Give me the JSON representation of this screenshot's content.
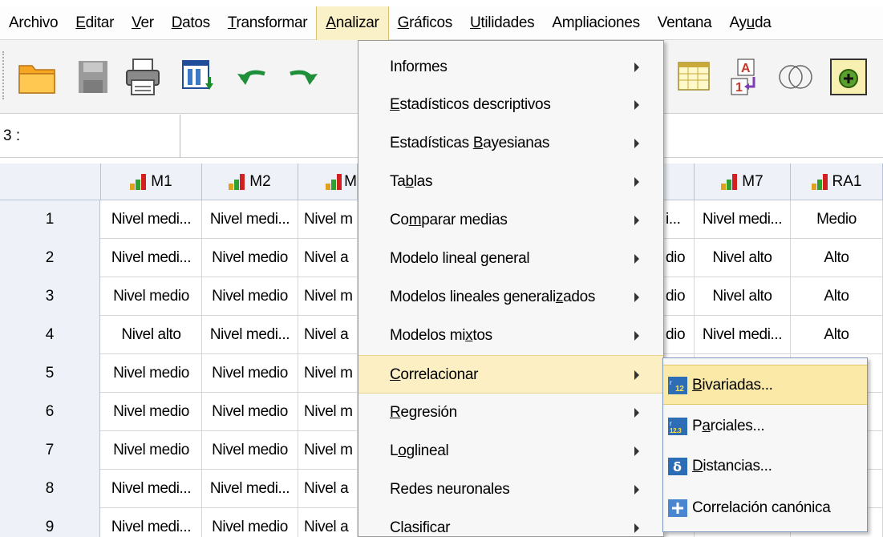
{
  "menubar": [
    {
      "pre": "Archivo",
      "u": "",
      "post": ""
    },
    {
      "pre": "",
      "u": "E",
      "post": "ditar"
    },
    {
      "pre": "",
      "u": "V",
      "post": "er"
    },
    {
      "pre": "",
      "u": "D",
      "post": "atos"
    },
    {
      "pre": "",
      "u": "T",
      "post": "ransformar"
    },
    {
      "pre": "",
      "u": "A",
      "post": "nalizar"
    },
    {
      "pre": "",
      "u": "G",
      "post": "ráficos"
    },
    {
      "pre": "",
      "u": "U",
      "post": "tilidades"
    },
    {
      "pre": "Ampliaciones",
      "u": "",
      "post": ""
    },
    {
      "pre": "Ventana",
      "u": "",
      "post": ""
    },
    {
      "pre": "Ay",
      "u": "u",
      "post": "da"
    }
  ],
  "cell_ref": "3 :",
  "columns": [
    {
      "label": "M1"
    },
    {
      "label": "M2"
    },
    {
      "label": "M"
    },
    {
      "label": "M7"
    },
    {
      "label": "RA1"
    }
  ],
  "rows": [
    {
      "n": "1",
      "m1": "Nivel medi...",
      "m2": "Nivel medi...",
      "m3": "Nivel m",
      "m6": "i...",
      "m7": "Nivel medi...",
      "ra1": "Medio"
    },
    {
      "n": "2",
      "m1": "Nivel medi...",
      "m2": "Nivel medio",
      "m3": "Nivel a",
      "m6": "dio",
      "m7": "Nivel alto",
      "ra1": "Alto"
    },
    {
      "n": "3",
      "m1": "Nivel medio",
      "m2": "Nivel medio",
      "m3": "Nivel m",
      "m6": "dio",
      "m7": "Nivel alto",
      "ra1": "Alto"
    },
    {
      "n": "4",
      "m1": "Nivel alto",
      "m2": "Nivel medi...",
      "m3": "Nivel a",
      "m6": "dio",
      "m7": "Nivel medi...",
      "ra1": "Alto"
    },
    {
      "n": "5",
      "m1": "Nivel medio",
      "m2": "Nivel medio",
      "m3": "Nivel m",
      "m6": "",
      "m7": "",
      "ra1": ""
    },
    {
      "n": "6",
      "m1": "Nivel medio",
      "m2": "Nivel medio",
      "m3": "Nivel m",
      "m6": "",
      "m7": "",
      "ra1": ""
    },
    {
      "n": "7",
      "m1": "Nivel medio",
      "m2": "Nivel medio",
      "m3": "Nivel m",
      "m6": "",
      "m7": "",
      "ra1": ""
    },
    {
      "n": "8",
      "m1": "Nivel medi...",
      "m2": "Nivel medi...",
      "m3": "Nivel a",
      "m6": "",
      "m7": "",
      "ra1": ""
    },
    {
      "n": "9",
      "m1": "Nivel medi...",
      "m2": "Nivel medio",
      "m3": "Nivel a",
      "m6": "",
      "m7": "",
      "ra1": ""
    }
  ],
  "analizar_menu": [
    {
      "pre": "Informes",
      "u": "",
      "post": ""
    },
    {
      "pre": "",
      "u": "E",
      "post": "stadísticos descriptivos"
    },
    {
      "pre": "Estadísticas ",
      "u": "B",
      "post": "ayesianas"
    },
    {
      "pre": "Ta",
      "u": "b",
      "post": "las"
    },
    {
      "pre": "Co",
      "u": "m",
      "post": "parar medias"
    },
    {
      "pre": "Modelo lineal ",
      "u": "g",
      "post": "eneral"
    },
    {
      "pre": "Modelos lineales generali",
      "u": "z",
      "post": "ados"
    },
    {
      "pre": "Modelos mi",
      "u": "x",
      "post": "tos"
    },
    {
      "pre": "",
      "u": "C",
      "post": "orrelacionar"
    },
    {
      "pre": "",
      "u": "R",
      "post": "egresión"
    },
    {
      "pre": "L",
      "u": "o",
      "post": "glineal"
    },
    {
      "pre": "Redes neuronales",
      "u": "",
      "post": ""
    },
    {
      "pre": "Clasificar",
      "u": "",
      "post": ""
    }
  ],
  "correlacionar_submenu": [
    {
      "pre": "",
      "u": "B",
      "post": "ivariadas...",
      "icon": "bivariate-icon"
    },
    {
      "pre": "P",
      "u": "a",
      "post": "rciales...",
      "icon": "partial-icon"
    },
    {
      "pre": "",
      "u": "D",
      "post": "istancias...",
      "icon": "distance-delta-icon"
    },
    {
      "pre": "Correlación canónica",
      "u": "",
      "post": "",
      "icon": "plus-icon"
    }
  ],
  "colors": {
    "highlight": "#fbefc3",
    "header_bg": "#eef1f7",
    "menu_bg": "#f7f7f7"
  }
}
